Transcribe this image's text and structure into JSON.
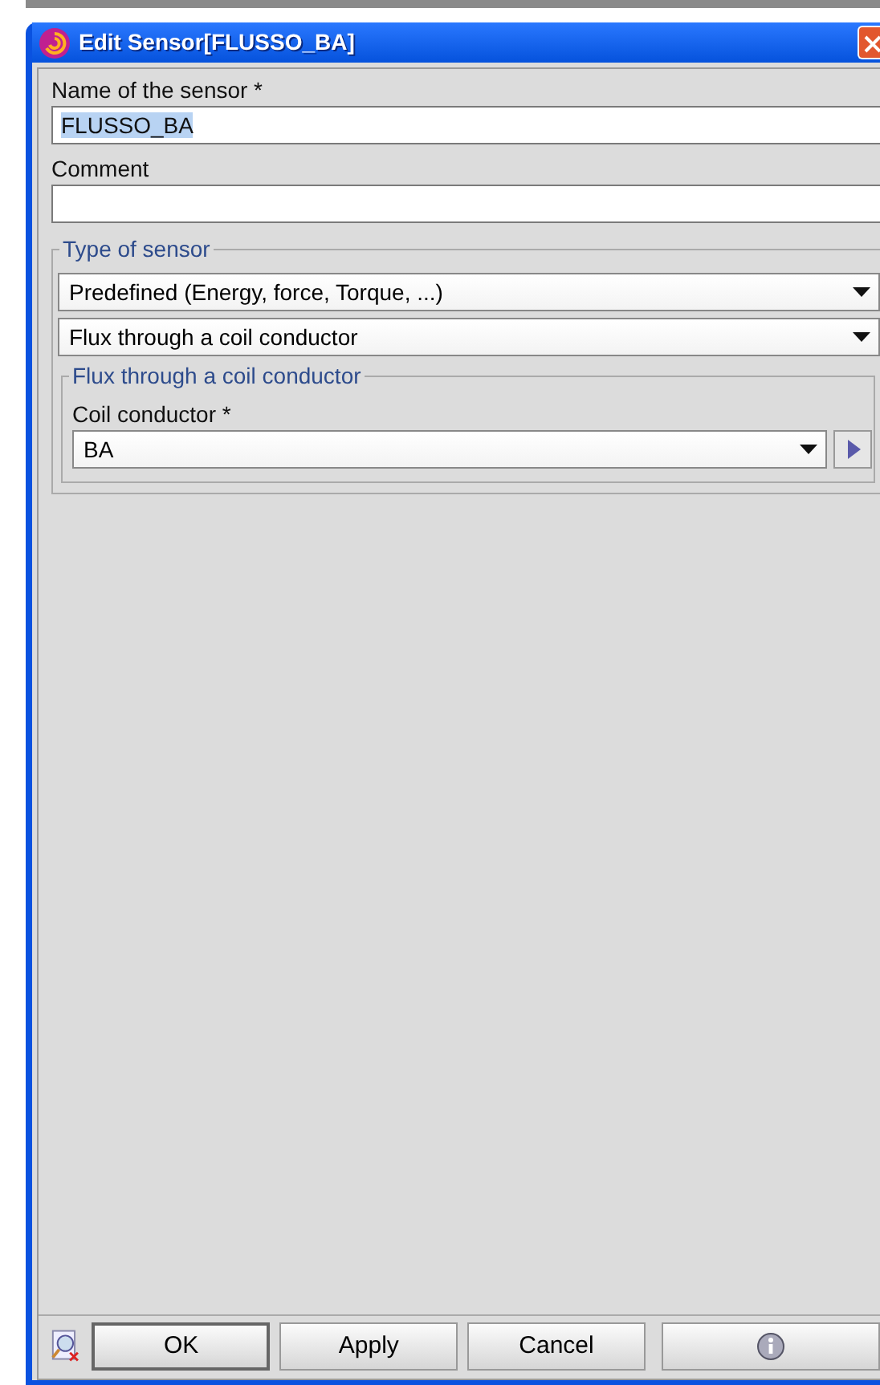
{
  "window": {
    "title": "Edit Sensor[FLUSSO_BA]"
  },
  "name_field": {
    "label": "Name of the sensor *",
    "value": "FLUSSO_BA",
    "text_selected": true
  },
  "comment_field": {
    "label": "Comment"
  },
  "type_group": {
    "legend": "Type of sensor",
    "dropdowns": [
      "Predefined (Energy, force, Torque, ...)",
      "Flux through a coil conductor"
    ],
    "subgroup": {
      "legend": "Flux through a coil conductor",
      "label": "Coil conductor *",
      "value": "BA"
    }
  },
  "buttons": [
    {
      "label": "OK",
      "default": true
    },
    {
      "label": "Apply",
      "default": false
    },
    {
      "label": "Cancel",
      "default": false
    }
  ]
}
